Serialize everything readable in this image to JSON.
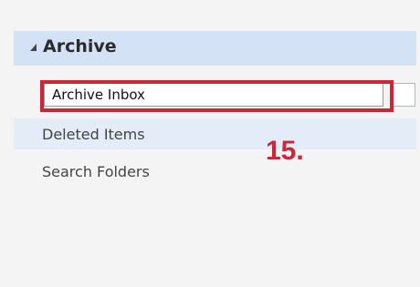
{
  "folder_pane": {
    "header": {
      "title": "Archive"
    },
    "rename": {
      "value": "Archive Inbox"
    },
    "items": [
      {
        "label": "Deleted Items"
      },
      {
        "label": "Search Folders"
      }
    ]
  },
  "annotation": {
    "step_label": "15."
  },
  "colors": {
    "header_bg": "#d3e2f5",
    "selected_bg": "#e3ecf7",
    "highlight": "#c8283a"
  }
}
